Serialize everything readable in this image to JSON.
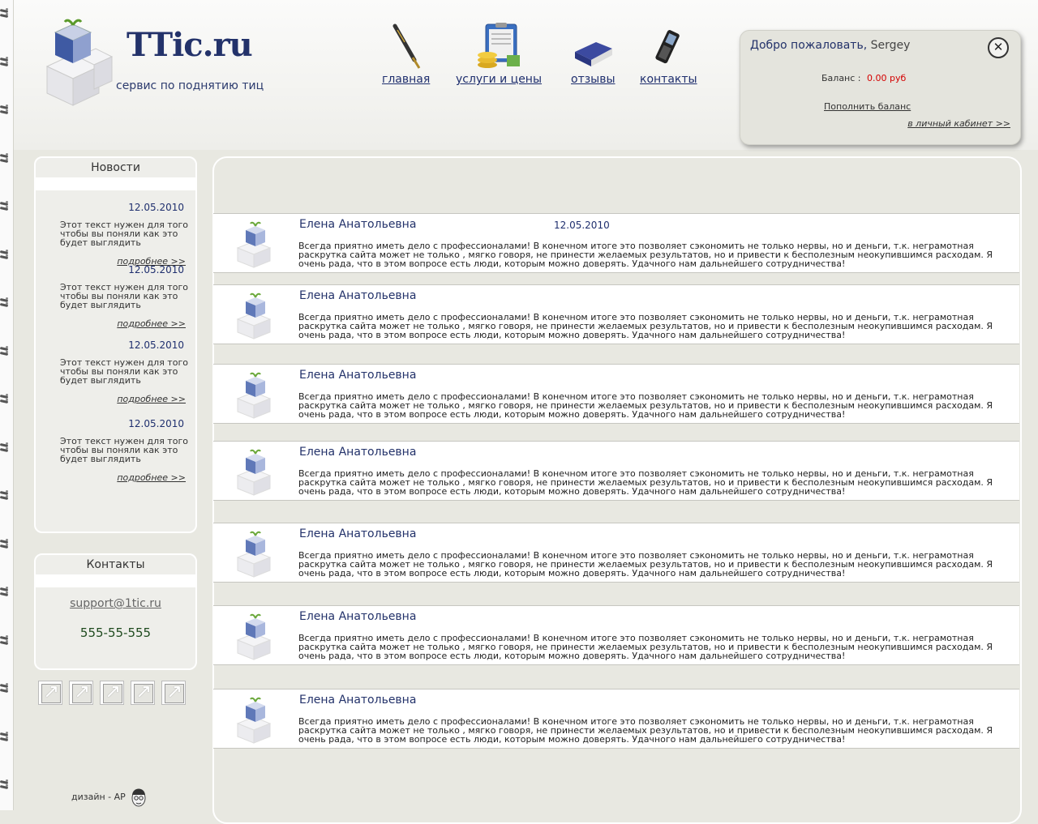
{
  "logo": {
    "title": "TTic.ru",
    "subtitle": "сервис по поднятию тиц"
  },
  "nav": [
    {
      "label": "главная",
      "icon": "pen-icon"
    },
    {
      "label": "услуги и цены",
      "icon": "coins-clipboard-icon"
    },
    {
      "label": "отзывы",
      "icon": "book-icon"
    },
    {
      "label": "контакты",
      "icon": "mobile-phone-icon"
    }
  ],
  "login": {
    "welcome": "Добро пожаловать,",
    "username": "Sergey",
    "balance_label": "Баланс :",
    "balance_value": "0.00 руб",
    "topup": "Пополнить баланс",
    "cabinet": "в личный кабинет >>",
    "balance_color": "#d40000"
  },
  "news": {
    "title": "Новости",
    "items": [
      {
        "date": "12.05.2010",
        "text": "Этот текст нужен для того чтобы вы поняли как это будет выглядить",
        "more": "подробнее >>"
      },
      {
        "date": "12.05.2010",
        "text": "Этот текст нужен для того чтобы вы поняли как это будет выглядить",
        "more": "подробнее >>"
      },
      {
        "date": "12.05.2010",
        "text": "Этот текст нужен для того чтобы вы поняли как это будет выглядить",
        "more": "подробнее >>"
      },
      {
        "date": "12.05.2010",
        "text": "Этот текст нужен для того чтобы вы поняли как это будет выглядить",
        "more": "подробнее >>"
      }
    ]
  },
  "contacts": {
    "title": "Контакты",
    "email": "support@1tic.ru",
    "phone": "555-55-555"
  },
  "footer": {
    "design": "дизайн - АР"
  },
  "reviews": [
    {
      "name": "Елена Анатольевна",
      "date": "12.05.2010",
      "text": "Всегда приятно иметь дело с профессионалами! В конечном итоге это позволяет сэкономить не только нервы, но и деньги, т.к. неграмотная раскрутка сайта может не только , мягко говоря, не принести желаемых результатов, но и привести к бесполезным неокупившимся расходам. Я очень рада, что в этом вопросе есть люди, которым можно доверять. Удачного нам дальнейшего сотрудничества!"
    },
    {
      "name": "Елена Анатольевна",
      "date": "",
      "text": "Всегда приятно иметь дело с профессионалами! В конечном итоге это позволяет сэкономить не только нервы, но и деньги, т.к. неграмотная раскрутка сайта может не только , мягко говоря, не принести желаемых результатов, но и привести к бесполезным неокупившимся расходам. Я очень рада, что в этом вопросе есть люди, которым можно доверять. Удачного нам дальнейшего сотрудничества!"
    },
    {
      "name": "Елена Анатольевна",
      "date": "",
      "text": "Всегда приятно иметь дело с профессионалами! В конечном итоге это позволяет сэкономить не только нервы, но и деньги, т.к. неграмотная раскрутка сайта может не только , мягко говоря, не принести желаемых результатов, но и привести к бесполезным неокупившимся расходам. Я очень рада, что в этом вопросе есть люди, которым можно доверять. Удачного нам дальнейшего сотрудничества!"
    },
    {
      "name": "Елена Анатольевна",
      "date": "",
      "text": "Всегда приятно иметь дело с профессионалами! В конечном итоге это позволяет сэкономить не только нервы, но и деньги, т.к. неграмотная раскрутка сайта может не только , мягко говоря, не принести желаемых результатов, но и привести к бесполезным неокупившимся расходам. Я очень рада, что в этом вопросе есть люди, которым можно доверять. Удачного нам дальнейшего сотрудничества!"
    },
    {
      "name": "Елена Анатольевна",
      "date": "",
      "text": "Всегда приятно иметь дело с профессионалами! В конечном итоге это позволяет сэкономить не только нервы, но и деньги, т.к. неграмотная раскрутка сайта может не только , мягко говоря, не принести желаемых результатов, но и привести к бесполезным неокупившимся расходам. Я очень рада, что в этом вопросе есть люди, которым можно доверять. Удачного нам дальнейшего сотрудничества!"
    },
    {
      "name": "Елена Анатольевна",
      "date": "",
      "text": "Всегда приятно иметь дело с профессионалами! В конечном итоге это позволяет сэкономить не только нервы, но и деньги, т.к. неграмотная раскрутка сайта может не только , мягко говоря, не принести желаемых результатов, но и привести к бесполезным неокупившимся расходам. Я очень рада, что в этом вопросе есть люди, которым можно доверять. Удачного нам дальнейшего сотрудничества!"
    },
    {
      "name": "Елена Анатольевна",
      "date": "",
      "text": "Всегда приятно иметь дело с профессионалами! В конечном итоге это позволяет сэкономить не только нервы, но и деньги, т.к. неграмотная раскрутка сайта может не только , мягко говоря, не принести желаемых результатов, но и привести к бесполезным неокупившимся расходам. Я очень рада, что в этом вопросе есть люди, которым можно доверять. Удачного нам дальнейшего сотрудничества!"
    }
  ],
  "social_icons": [
    "share-icon",
    "share-icon",
    "share-icon",
    "share-icon",
    "share-icon"
  ]
}
